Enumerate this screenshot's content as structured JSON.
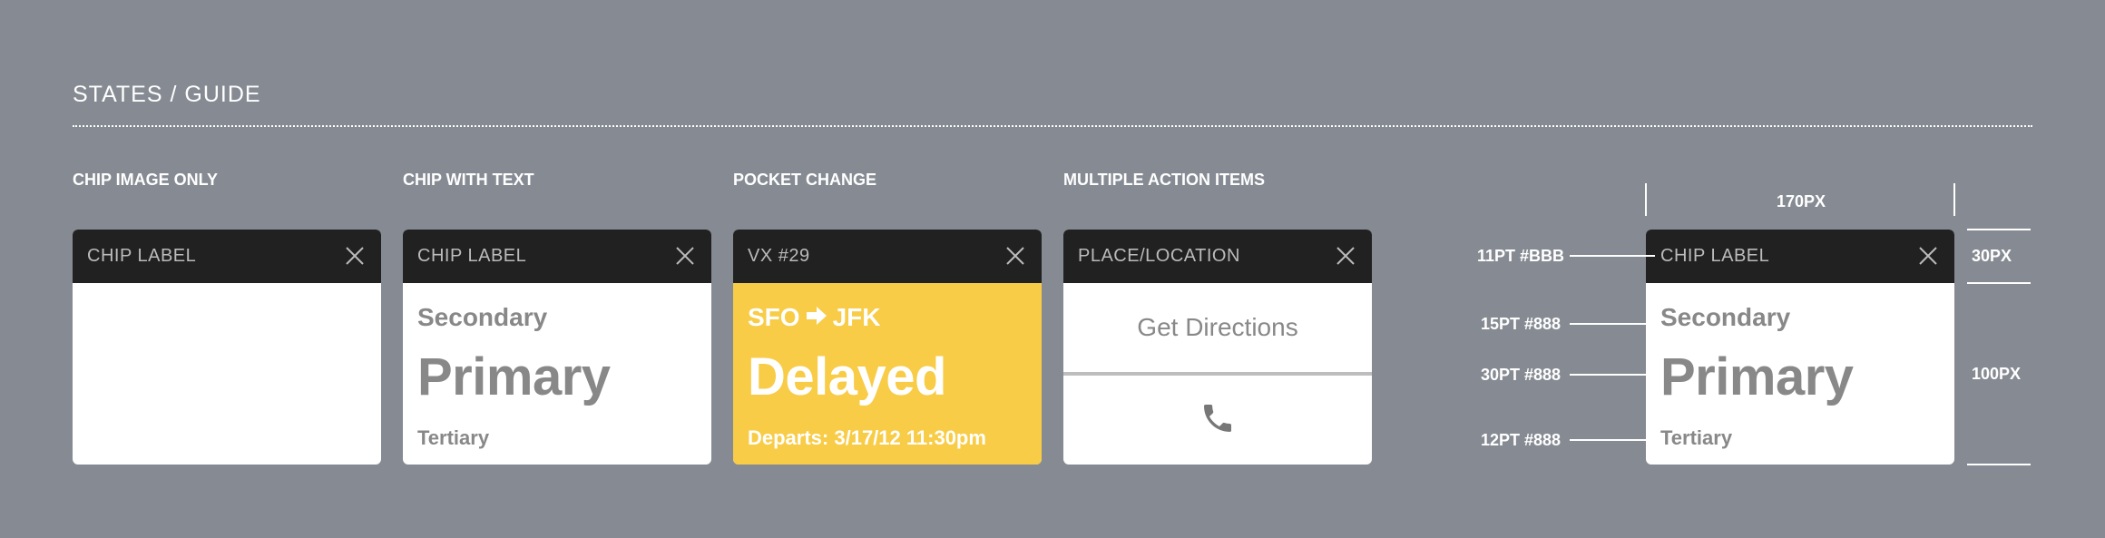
{
  "page": {
    "title": "STATES / GUIDE"
  },
  "sections": [
    {
      "label": "CHIP IMAGE ONLY"
    },
    {
      "label": "CHIP WITH TEXT"
    },
    {
      "label": "POCKET CHANGE"
    },
    {
      "label": "MULTIPLE ACTION ITEMS"
    }
  ],
  "chips": {
    "image_only": {
      "label": "CHIP LABEL"
    },
    "with_text": {
      "label": "CHIP LABEL",
      "secondary": "Secondary",
      "primary": "Primary",
      "tertiary": "Tertiary"
    },
    "pocket_change": {
      "label": "VX #29",
      "route_from": "SFO",
      "route_to": "JFK",
      "primary": "Delayed",
      "tertiary": "Departs: 3/17/12  11:30pm",
      "background_color": "#f8cc46"
    },
    "multiple_actions": {
      "label": "PLACE/LOCATION",
      "action_1": "Get Directions",
      "action_2_icon": "phone-icon"
    },
    "spec": {
      "label": "CHIP LABEL",
      "secondary": "Secondary",
      "primary": "Primary",
      "tertiary": "Tertiary"
    }
  },
  "spec_annotations": {
    "width": "170PX",
    "header_height": "30PX",
    "body_height": "100PX",
    "label_style": "11PT #BBB",
    "secondary_style": "15PT #888",
    "primary_style": "30PT #888",
    "tertiary_style": "12PT #888"
  },
  "colors": {
    "background": "#868b93",
    "header": "#212121",
    "label": "#bbbbbb",
    "text": "#888888",
    "accent_yellow": "#f8cc46"
  }
}
